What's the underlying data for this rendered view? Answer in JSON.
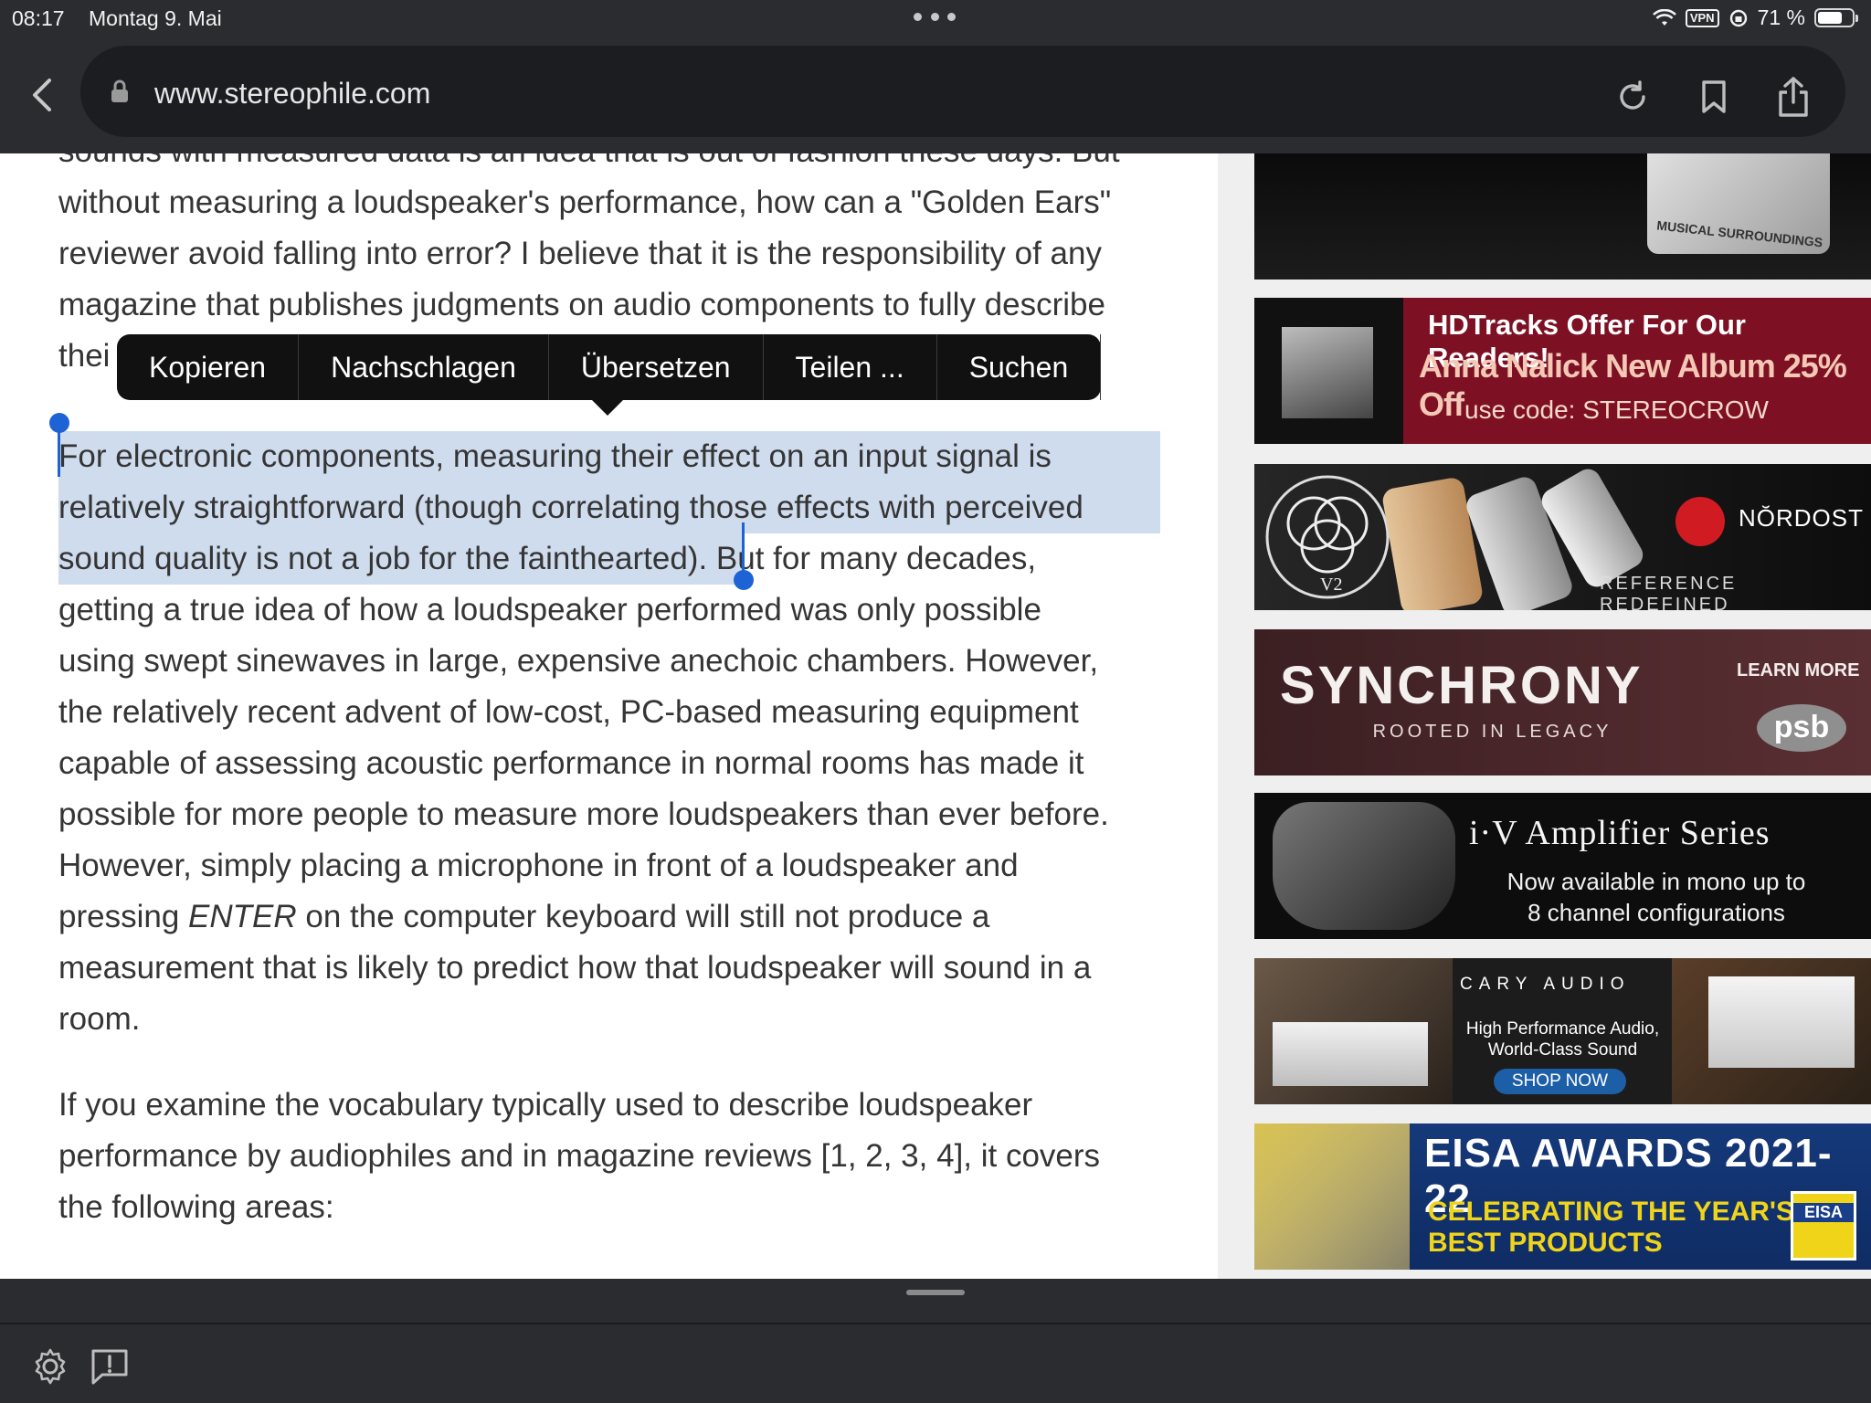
{
  "status_bar": {
    "time": "08:17",
    "date": "Montag 9. Mai",
    "vpn": "VPN",
    "battery": "71 %",
    "battery_level": 0.71
  },
  "browser": {
    "url": "www.stereophile.com",
    "icons": [
      "back-arrow-icon",
      "lock-icon",
      "reload-icon",
      "bookmark-icon",
      "share-icon"
    ]
  },
  "article": {
    "paragraph1_lines": [
      "sounds with measured data is an idea that is out of fashion these days. But",
      "without measuring a loudspeaker's performance, how can a \"Golden Ears\"",
      "reviewer avoid falling into error? I believe that it is the responsibility of any",
      "magazine that publishes judgments on audio components to fully describe",
      "thei"
    ],
    "paragraph2": {
      "selected_lines": [
        "For electronic components, measuring their effect on an input signal is",
        "relatively straightforward (though correlating those effects with perceived",
        "sound quality is not a job for the fainthearted)."
      ],
      "rest_of_line3": " But for many decades,",
      "lines": [
        "getting a true idea of how a loudspeaker performed was only possible",
        "using swept sinewaves in large, expensive anechoic chambers. However,",
        "the relatively recent advent of low-cost, PC-based measuring equipment",
        "capable of assessing acoustic performance in normal rooms has made it",
        "possible for more people to measure more loudspeakers than ever before.",
        "However, simply placing a microphone in front of a loudspeaker and"
      ],
      "line_pressing_before": "pressing ",
      "line_pressing_em": "ENTER",
      "line_pressing_after": " on the computer keyboard will still not produce a",
      "tail_lines": [
        "measurement that is likely to predict how that loudspeaker will sound in a",
        "room."
      ]
    },
    "paragraph3_lines": [
      "If you examine the vocabulary typically used to describe loudspeaker",
      "performance by audiophiles and in magazine reviews [1, 2, 3, 4], it covers",
      "the following areas:"
    ]
  },
  "context_menu": {
    "items": [
      "Kopieren",
      "Nachschlagen",
      "Übersetzen",
      "Teilen ...",
      "Suchen"
    ]
  },
  "ads": {
    "top": {
      "label": "MUSICAL SURROUNDINGS"
    },
    "hdtracks": {
      "line1": "HDTracks Offer For Our Readers!",
      "line2": "Anna Nalick New Album 25% Off",
      "line3": "use code: STEREOCROW"
    },
    "nordost": {
      "brand": "NŎRDOST",
      "tagline": "REFERENCE REDEFINED",
      "badge": "V2"
    },
    "synchrony": {
      "title": "SYNCHRONY",
      "subtitle": "ROOTED IN LEGACY",
      "cta": "LEARN MORE",
      "logo": "psb"
    },
    "iv": {
      "title": "i·V Amplifier Series",
      "line1": "Now available in mono up to",
      "line2": "8 channel configurations"
    },
    "cary": {
      "brand": "CARY AUDIO",
      "line1": "High Performance Audio,",
      "line2": "World-Class Sound",
      "cta": "SHOP NOW"
    },
    "eisa": {
      "title": "EISA AWARDS 2021-22",
      "line1": "CELEBRATING THE YEAR'S",
      "line2": "BEST PRODUCTS",
      "badge": "EISA"
    }
  },
  "bottom_bar": {
    "icons": [
      "settings-gear-icon",
      "feedback-icon"
    ]
  }
}
